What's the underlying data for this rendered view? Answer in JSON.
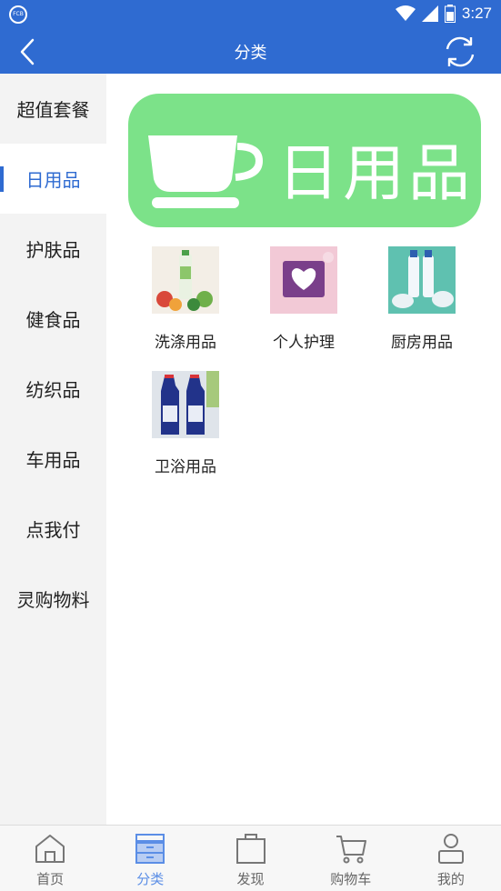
{
  "status": {
    "time": "3:27",
    "app_badge": "FCB"
  },
  "header": {
    "title": "分类"
  },
  "sidebar": {
    "items": [
      {
        "label": "超值套餐"
      },
      {
        "label": "日用品"
      },
      {
        "label": "护肤品"
      },
      {
        "label": "健食品"
      },
      {
        "label": "纺织品"
      },
      {
        "label": "车用品"
      },
      {
        "label": "点我付"
      },
      {
        "label": "灵购物料"
      }
    ],
    "active": 1
  },
  "banner": {
    "text": "日用品",
    "color": "#7ce289"
  },
  "categories": [
    {
      "label": "洗涤用品",
      "icon": "detergent-image"
    },
    {
      "label": "个人护理",
      "icon": "personal-care-image"
    },
    {
      "label": "厨房用品",
      "icon": "kitchen-image"
    },
    {
      "label": "卫浴用品",
      "icon": "bathroom-image"
    }
  ],
  "tabbar": {
    "tabs": [
      {
        "label": "首页",
        "icon": "home-icon"
      },
      {
        "label": "分类",
        "icon": "category-icon"
      },
      {
        "label": "发现",
        "icon": "discover-icon"
      },
      {
        "label": "购物车",
        "icon": "cart-icon"
      },
      {
        "label": "我的",
        "icon": "profile-icon"
      }
    ],
    "active": 1
  },
  "colors": {
    "primary": "#2f6bd1",
    "active_tab": "#5b8ee6",
    "sidebar_bg": "#f3f3f3"
  }
}
